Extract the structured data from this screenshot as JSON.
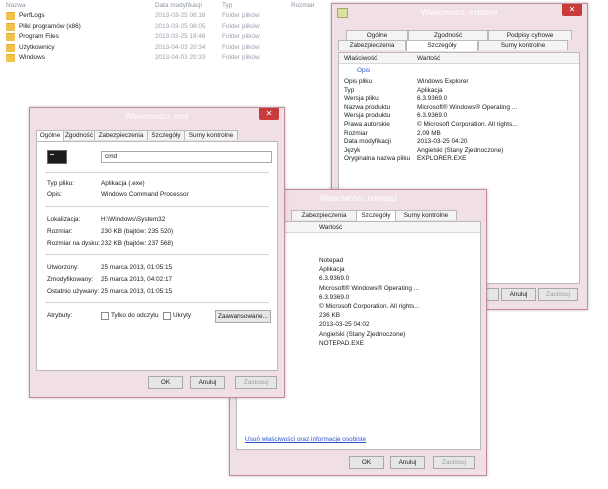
{
  "file_list": {
    "headers": {
      "name": "Nazwa",
      "date": "Data modyfikacji",
      "type": "Typ",
      "size": "Rozmiar"
    },
    "rows": [
      {
        "name": "PerfLogs",
        "date": "2013-03-25 08:16",
        "type": "Folder plików"
      },
      {
        "name": "Pliki programów (x86)",
        "date": "2013-03-25 08:05",
        "type": "Folder plików"
      },
      {
        "name": "Program Files",
        "date": "2013-03-25 19:46",
        "type": "Folder plików"
      },
      {
        "name": "Użytkownicy",
        "date": "2013-04-03 20:34",
        "type": "Folder plików"
      },
      {
        "name": "Windows",
        "date": "2013-04-03 20:33",
        "type": "Folder plików"
      }
    ]
  },
  "explorer_dialog": {
    "title": "Właściwości: explorer",
    "tabs_top": [
      "Ogólne",
      "Zgodność",
      "Podpisy cyfrowe"
    ],
    "tabs_bottom": [
      "Zabezpieczenia",
      "Szczegóły",
      "Sumy kontrolne"
    ],
    "grid": {
      "col_property": "Właściwość",
      "col_value": "Wartość",
      "section": "Opis",
      "rows": [
        {
          "k": "Opis pliku",
          "v": "Windows Explorer"
        },
        {
          "k": "Typ",
          "v": "Aplikacja"
        },
        {
          "k": "Wersja pliku",
          "v": "6.3.9369.0"
        },
        {
          "k": "Nazwa produktu",
          "v": "Microsoft® Windows® Operating ..."
        },
        {
          "k": "Wersja produktu",
          "v": "6.3.9369.0"
        },
        {
          "k": "Prawa autorskie",
          "v": "© Microsoft Corporation. All rights..."
        },
        {
          "k": "Rozmiar",
          "v": "2,09 MB"
        },
        {
          "k": "Data modyfikacji",
          "v": "2013-03-25 04:20"
        },
        {
          "k": "Język",
          "v": "Angielski (Stany Zjednoczone)"
        },
        {
          "k": "Oryginalna nazwa pliku",
          "v": "EXPLORER.EXE"
        }
      ]
    },
    "buttons": {
      "ok": "OK",
      "cancel": "Anuluj",
      "apply": "Zastosuj"
    }
  },
  "notepad_dialog": {
    "title": "Właściwości: notepad",
    "tabs": [
      "Zabezpieczenia",
      "Szczegóły",
      "Sumy kontrolne"
    ],
    "grid": {
      "col_value": "Wartość",
      "rows": [
        {
          "k": "",
          "v": "Notepad"
        },
        {
          "k": "",
          "v": "Aplikacja"
        },
        {
          "k": "",
          "v": "6.3.9369.0"
        },
        {
          "k": "utu",
          "v": "Microsoft® Windows® Operating ..."
        },
        {
          "k": "utu",
          "v": "6.3.9369.0"
        },
        {
          "k": "e",
          "v": "© Microsoft Corporation. All rights..."
        },
        {
          "k": "",
          "v": "236 KB"
        },
        {
          "k": "kji",
          "v": "2013-03-25 04:02"
        },
        {
          "k": "",
          "v": "Angielski (Stany Zjednoczone)"
        },
        {
          "k": "zwa pliku",
          "v": "NOTEPAD.EXE"
        }
      ]
    },
    "remove_link": "Usuń właściwości oraz informacje osobiste",
    "buttons": {
      "ok": "OK",
      "cancel": "Anuluj",
      "apply": "Zastosuj"
    }
  },
  "cmd_dialog": {
    "title": "Właściwości: cmd",
    "tabs": [
      "Ogólne",
      "Zgodność",
      "Zabezpieczenia",
      "Szczegóły",
      "Sumy kontrolne"
    ],
    "file_name": "cmd",
    "fields": {
      "type_label": "Typ pliku:",
      "type_value": "Aplikacja (.exe)",
      "desc_label": "Opis:",
      "desc_value": "Windows Command Processor",
      "location_label": "Lokalizacja:",
      "location_value": "H:\\Windows\\System32",
      "size_label": "Rozmiar:",
      "size_value": "230 KB (bajtów: 235 520)",
      "disk_label": "Rozmiar na dysku:",
      "disk_value": "232 KB (bajtów: 237 568)",
      "created_label": "Utworzony:",
      "created_value": "25 marca 2013, 01:05:15",
      "modified_label": "Zmodyfikowany:",
      "modified_value": "25 marca 2013, 04:02:17",
      "accessed_label": "Ostatnio używany:",
      "accessed_value": "25 marca 2013, 01:05:15",
      "attr_label": "Atrybuty:",
      "readonly_label": "Tylko do odczytu",
      "hidden_label": "Ukryty",
      "advanced_button": "Zaawansowane..."
    },
    "buttons": {
      "ok": "OK",
      "cancel": "Anuluj",
      "apply": "Zastosuj"
    }
  }
}
